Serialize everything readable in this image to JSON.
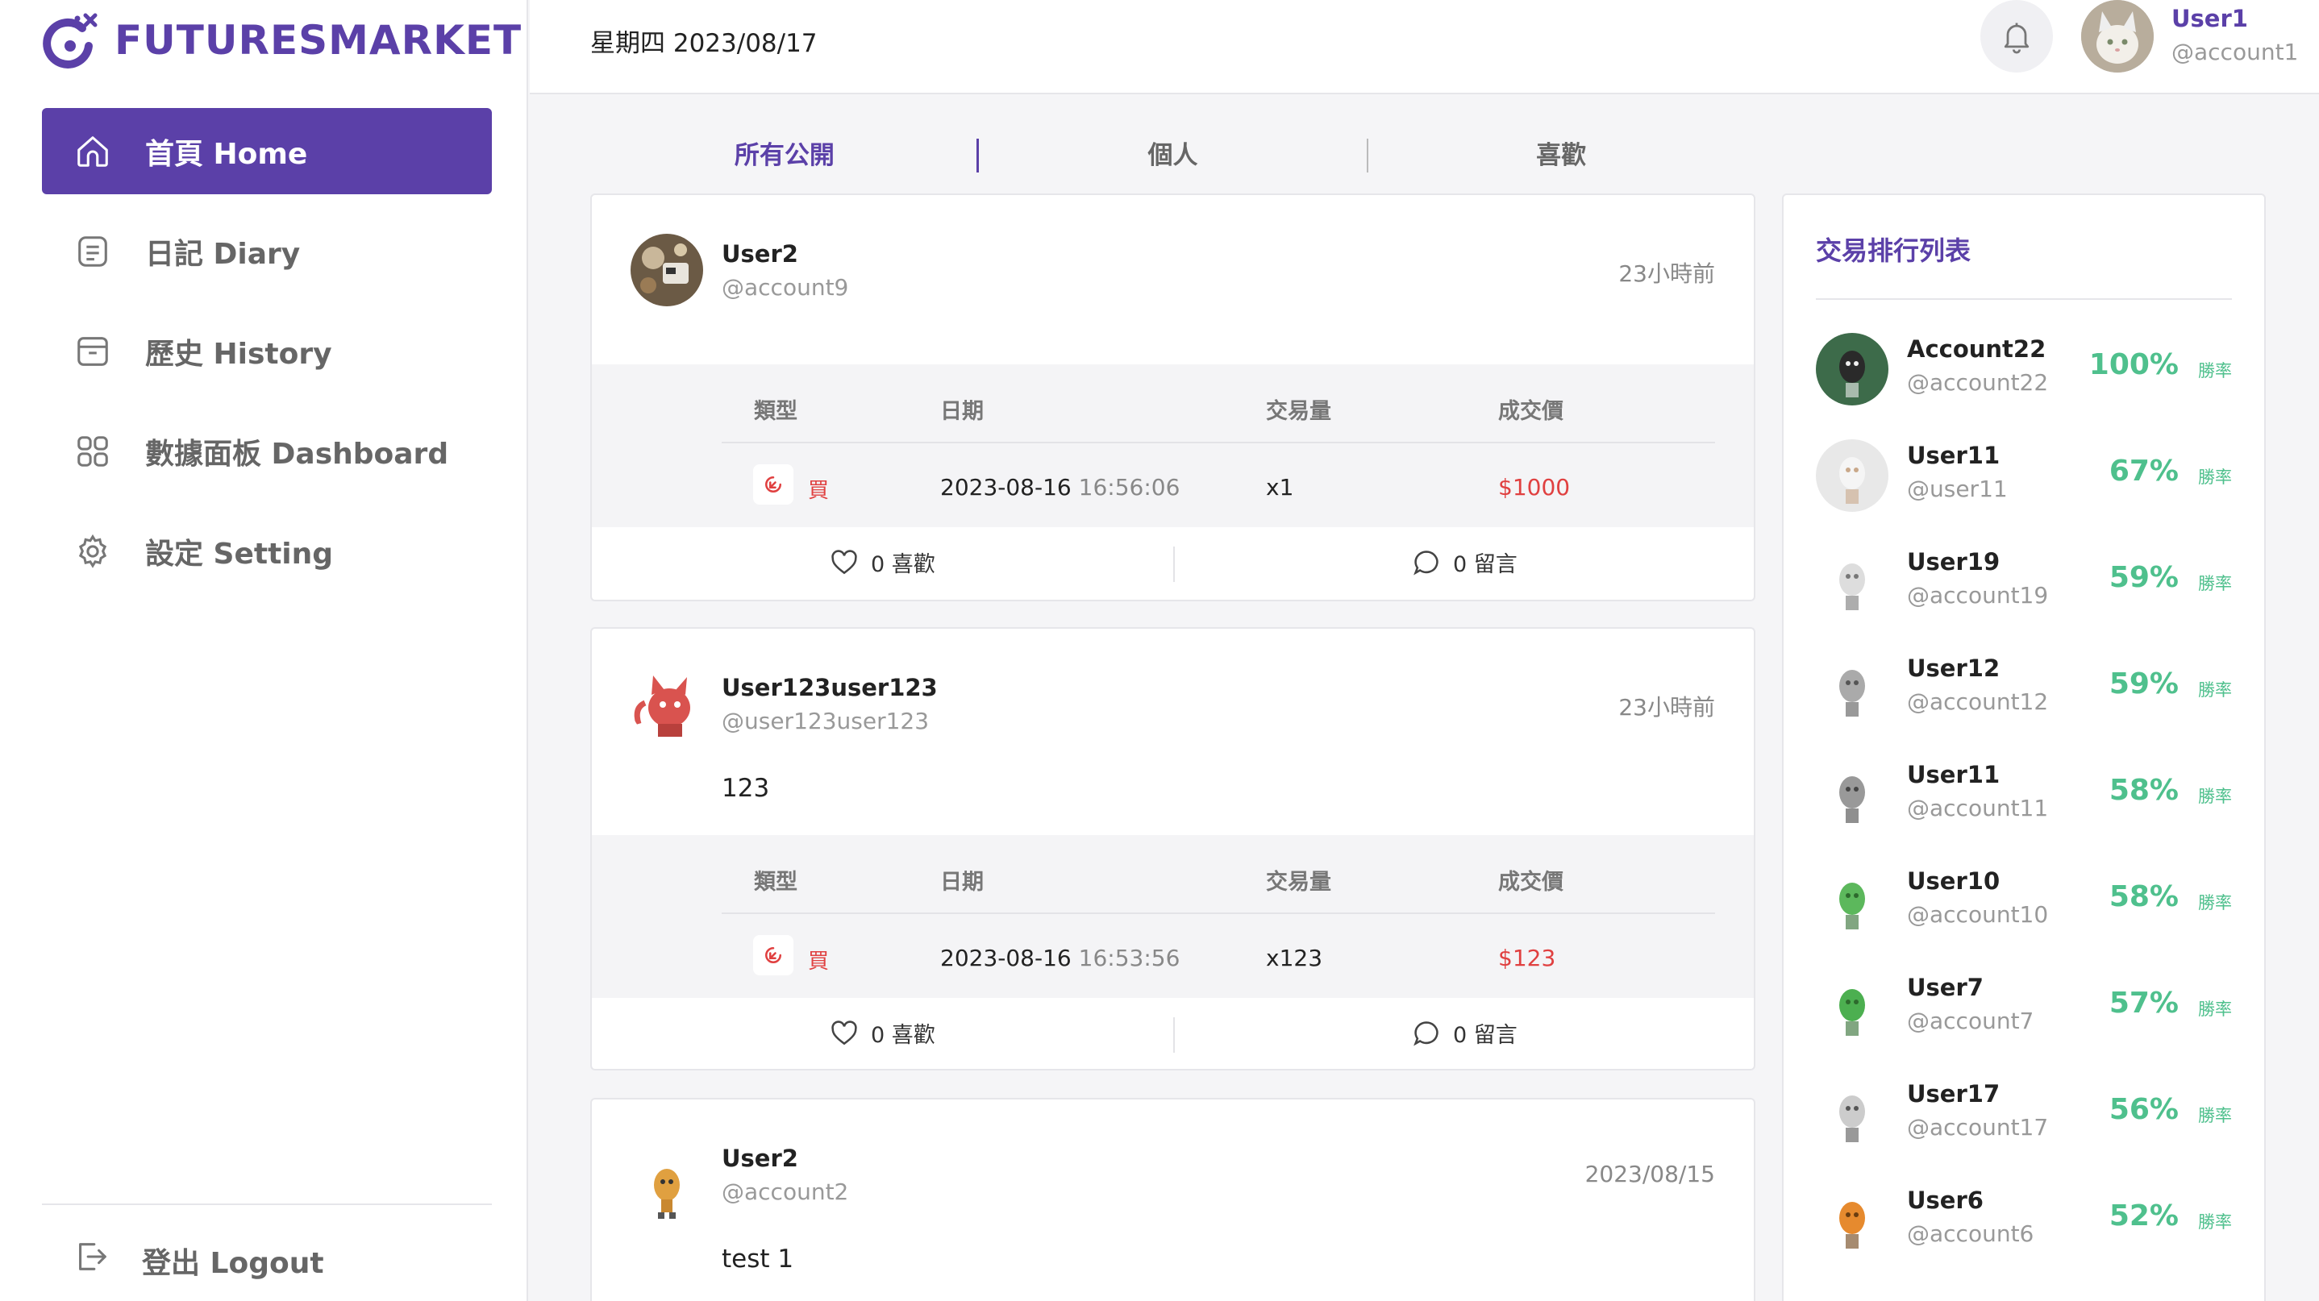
{
  "brand": {
    "name": "FUTURESMARKET",
    "color": "#5b40a8"
  },
  "sidebar": {
    "items": [
      {
        "label": "首頁  Home",
        "icon": "home-icon",
        "active": true
      },
      {
        "label": "日記  Diary",
        "icon": "diary-icon"
      },
      {
        "label": "歷史  History",
        "icon": "history-icon"
      },
      {
        "label": "數據面板  Dashboard",
        "icon": "dashboard-icon"
      },
      {
        "label": "設定  Setting",
        "icon": "gear-icon"
      }
    ],
    "logout": "登出  Logout"
  },
  "header": {
    "date": "星期四  2023/08/17",
    "user": {
      "name": "User1",
      "handle": "@account1"
    }
  },
  "tabs": [
    "所有公開",
    "個人",
    "喜歡"
  ],
  "trade_headers": {
    "type": "類型",
    "date": "日期",
    "volume": "交易量",
    "price": "成交價"
  },
  "posts": [
    {
      "user": "User2",
      "handle": "@account9",
      "time": "23小時前",
      "text": "",
      "trade": {
        "type": "買",
        "date": "2023-08-16",
        "time": "16:56:06",
        "volume": "x1",
        "price": "$1000"
      },
      "likes": "0 喜歡",
      "comments": "0 留言"
    },
    {
      "user": "User123user123",
      "handle": "@user123user123",
      "time": "23小時前",
      "text": "123",
      "trade": {
        "type": "買",
        "date": "2023-08-16",
        "time": "16:53:56",
        "volume": "x123",
        "price": "$123"
      },
      "likes": "0 喜歡",
      "comments": "0 留言"
    },
    {
      "user": "User2",
      "handle": "@account2",
      "time": "2023/08/15",
      "text": "test 1"
    }
  ],
  "ranking": {
    "title": "交易排行列表",
    "win_label": "勝率",
    "rows": [
      {
        "name": "Account22",
        "handle": "@account22",
        "pct": "100%"
      },
      {
        "name": "User11",
        "handle": "@user11",
        "pct": "67%"
      },
      {
        "name": "User19",
        "handle": "@account19",
        "pct": "59%"
      },
      {
        "name": "User12",
        "handle": "@account12",
        "pct": "59%"
      },
      {
        "name": "User11",
        "handle": "@account11",
        "pct": "58%"
      },
      {
        "name": "User10",
        "handle": "@account10",
        "pct": "58%"
      },
      {
        "name": "User7",
        "handle": "@account7",
        "pct": "57%"
      },
      {
        "name": "User17",
        "handle": "@account17",
        "pct": "56%"
      },
      {
        "name": "User6",
        "handle": "@account6",
        "pct": "52%"
      }
    ]
  },
  "colors": {
    "accent": "#5b40a8",
    "buy": "#e04040",
    "win": "#4fc08d"
  }
}
